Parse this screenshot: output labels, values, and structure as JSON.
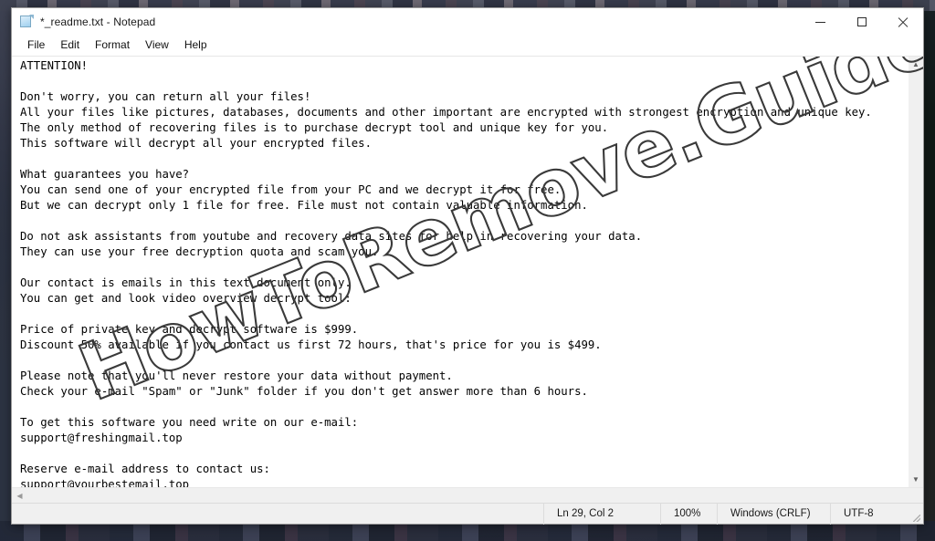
{
  "window": {
    "title": "*_readme.txt - Notepad",
    "icon": "notepad-document-icon",
    "controls": {
      "minimize": "minimize-icon",
      "maximize": "maximize-icon",
      "close": "close-icon"
    }
  },
  "menubar": {
    "items": [
      {
        "label": "File"
      },
      {
        "label": "Edit"
      },
      {
        "label": "Format"
      },
      {
        "label": "View"
      },
      {
        "label": "Help"
      }
    ]
  },
  "document": {
    "lines": [
      "ATTENTION!",
      "",
      "Don't worry, you can return all your files!",
      "All your files like pictures, databases, documents and other important are encrypted with strongest encryption and unique key.",
      "The only method of recovering files is to purchase decrypt tool and unique key for you.",
      "This software will decrypt all your encrypted files.",
      "",
      "What guarantees you have?",
      "You can send one of your encrypted file from your PC and we decrypt it for free.",
      "But we can decrypt only 1 file for free. File must not contain valuable information.",
      "",
      "Do not ask assistants from youtube and recovery data sites for help in recovering your data.",
      "They can use your free decryption quota and scam you.",
      "",
      "Our contact is emails in this text document only.",
      "You can get and look video overview decrypt tool:",
      "",
      "Price of private key and decrypt software is $999.",
      "Discount 50% available if you contact us first 72 hours, that's price for you is $499.",
      "",
      "Please note that you'll never restore your data without payment.",
      "Check your e-mail \"Spam\" or \"Junk\" folder if you don't get answer more than 6 hours.",
      "",
      "To get this software you need write on our e-mail:",
      "support@freshingmail.top",
      "",
      "Reserve e-mail address to contact us:",
      "support@yourbestemail.top"
    ]
  },
  "watermark": {
    "text": "HowToRemove.Guide",
    "style": "outlined-diagonal",
    "rotation_deg": -22,
    "stroke_color": "#3a3a3a"
  },
  "scrollbars": {
    "vertical": {
      "up_arrow": "chevron-up-icon",
      "down_arrow": "chevron-down-icon"
    },
    "horizontal": {
      "left_arrow": "chevron-left-icon",
      "right_arrow": "chevron-right-icon"
    }
  },
  "statusbar": {
    "cursor_position": "Ln 29, Col 2",
    "zoom": "100%",
    "line_ending": "Windows (CRLF)",
    "encoding": "UTF-8",
    "resize_grip": "resize-grip-icon"
  }
}
